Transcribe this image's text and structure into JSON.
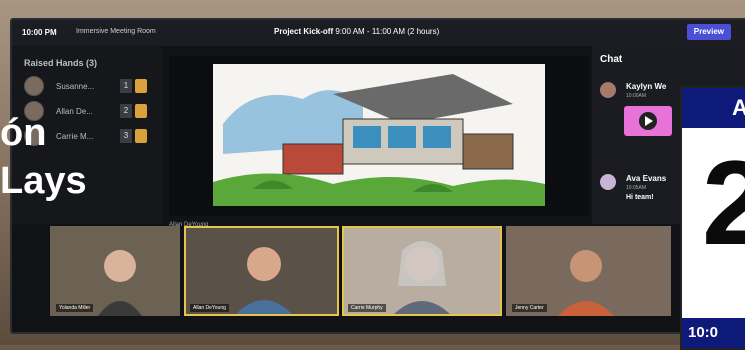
{
  "topbar": {
    "time": "10:00 PM",
    "room": "Immersive Meeting Room",
    "meeting_title": "Project Kick-off",
    "meeting_time": "9:00 AM - 11:00 AM (2 hours)",
    "preview_label": "Preview"
  },
  "raised_hands": {
    "title": "Raised Hands (3)",
    "items": [
      {
        "name": "Susanne...",
        "num": "1"
      },
      {
        "name": "Allan De...",
        "num": "2"
      },
      {
        "name": "Carrie M...",
        "num": "3"
      }
    ]
  },
  "overlay": {
    "line1": "ón",
    "line2": "Lays"
  },
  "shared_screen": {
    "caption": "Allan DeYoung"
  },
  "chat": {
    "title": "Chat",
    "messages": [
      {
        "name": "Kaylyn We",
        "time": "10:00AM",
        "text": ""
      },
      {
        "name": "Ava Evans",
        "time": "10:05AM",
        "text": "Hi team!"
      }
    ]
  },
  "participants": [
    {
      "label": "Yolanda Miller"
    },
    {
      "label": "Allan DeYoung"
    },
    {
      "label": "Carrie Murphy"
    },
    {
      "label": "Jenny Carter"
    }
  ],
  "calendar": {
    "month_fragment": "A",
    "day_fragment": "2",
    "time_fragment": "10:0"
  },
  "colors": {
    "preview": "#4a4fd6",
    "calendar_blue": "#0d1a7a",
    "active_speaker": "#e5c54a",
    "media_pink": "#e773d9"
  }
}
